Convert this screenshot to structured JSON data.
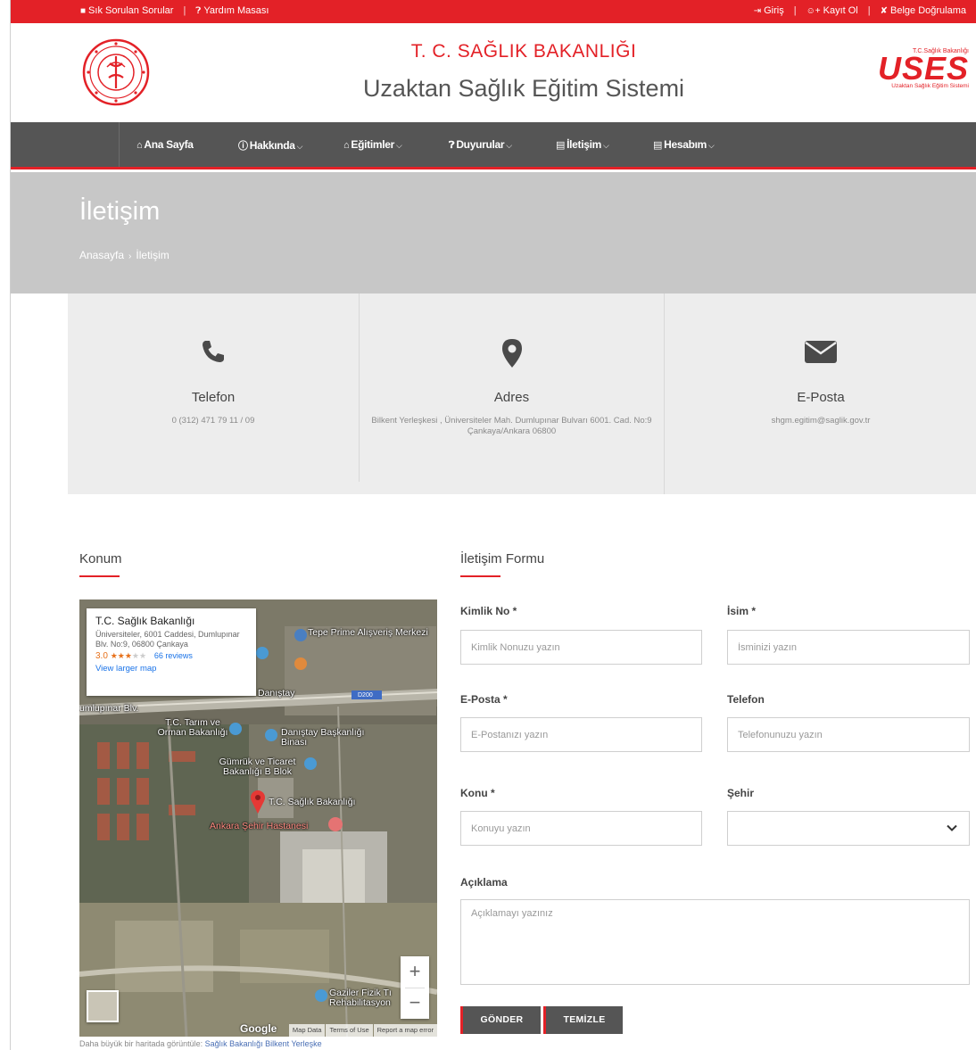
{
  "topbar": {
    "faq": "Sık Sorulan Sorular",
    "helpdesk": "Yardım Masası",
    "login": "Giriş",
    "register": "Kayıt Ol",
    "verify": "Belge Doğrulama",
    "separator": "|"
  },
  "header": {
    "ministry": "T. C. SAĞLIK BAKANLIĞI",
    "system": "Uzaktan Sağlık Eğitim Sistemi",
    "logo_right_top": "T.C.Sağlık Bakanlığı",
    "logo_right_main": "USES",
    "logo_right_sub": "Uzaktan Sağlık Eğitim Sistemi"
  },
  "nav": {
    "items": [
      {
        "label": "Ana Sayfa",
        "icon": "home-icon",
        "dropdown": false
      },
      {
        "label": "Hakkında",
        "icon": "info-icon",
        "dropdown": true
      },
      {
        "label": "Eğitimler",
        "icon": "institution-icon",
        "dropdown": true
      },
      {
        "label": "Duyurular",
        "icon": "question-icon",
        "dropdown": true
      },
      {
        "label": "İletişim",
        "icon": "contact-card-icon",
        "dropdown": true
      },
      {
        "label": "Hesabım",
        "icon": "contact-card-icon",
        "dropdown": true
      }
    ]
  },
  "banner": {
    "title": "İletişim",
    "breadcrumb_home": "Anasayfa",
    "breadcrumb_current": "İletişim"
  },
  "contact": {
    "phone_label": "Telefon",
    "phone_value": "0 (312) 471 79 11 / 09",
    "address_label": "Adres",
    "address_value": "Bilkent Yerleşkesi , Üniversiteler Mah. Dumlupınar Bulvarı 6001. Cad. No:9 Çankaya/Ankara 06800",
    "email_label": "E-Posta",
    "email_value": "shgm.egitim@saglik.gov.tr"
  },
  "location": {
    "title": "Konum",
    "map": {
      "place_name": "T.C. Sağlık Bakanlığı",
      "place_address": "Üniversiteler, 6001 Caddesi, Dumlupınar Blv. No:9, 06800 Çankaya",
      "rating": "3.0",
      "reviews": "66 reviews",
      "larger_map": "View larger map",
      "labels": {
        "tepe_prime": "Tepe Prime Alışveriş Merkezi",
        "danistay": "Danıştay",
        "dumlupinar": "umlupınar Blv.",
        "tarim": "T.C. Tarım ve Orman Bakanlığı",
        "danistay_bina": "Danıştay Başkanlığı Binası",
        "gumruk": "Gümrük ve Ticaret Bakanlığı B Blok",
        "saglik": "T.C. Sağlık Bakanlığı",
        "sehir_hastanesi": "Ankara Şehir Hastanesi",
        "gaziler": "Gaziler Fizik Tı Rehabilitasyon",
        "road": "D200"
      },
      "zoom_in": "+",
      "zoom_out": "−",
      "footer_map_data": "Map Data",
      "footer_terms": "Terms of Use",
      "footer_report": "Report a map error",
      "google": "Google"
    },
    "note_prefix": "Daha büyük bir haritada görüntüle:",
    "note_link": "Sağlık Bakanlığı Bilkent Yerleşke"
  },
  "form": {
    "title": "İletişim Formu",
    "kimlik_label": "Kimlik No *",
    "kimlik_placeholder": "Kimlik Nonuzu yazın",
    "isim_label": "İsim *",
    "isim_placeholder": "İsminizi yazın",
    "eposta_label": "E-Posta *",
    "eposta_placeholder": "E-Postanızı yazın",
    "telefon_label": "Telefon",
    "telefon_placeholder": "Telefonunuzu yazın",
    "konu_label": "Konu *",
    "konu_placeholder": "Konuyu yazın",
    "sehir_label": "Şehir",
    "sehir_value": "",
    "aciklama_label": "Açıklama",
    "aciklama_placeholder": "Açıklamayı yazınız",
    "submit": "GÖNDER",
    "reset": "TEMİZLE"
  },
  "colors": {
    "accent": "#e32127",
    "nav_bg": "#555555",
    "banner_bg": "#c7c7c7",
    "cards_bg": "#ededed"
  }
}
